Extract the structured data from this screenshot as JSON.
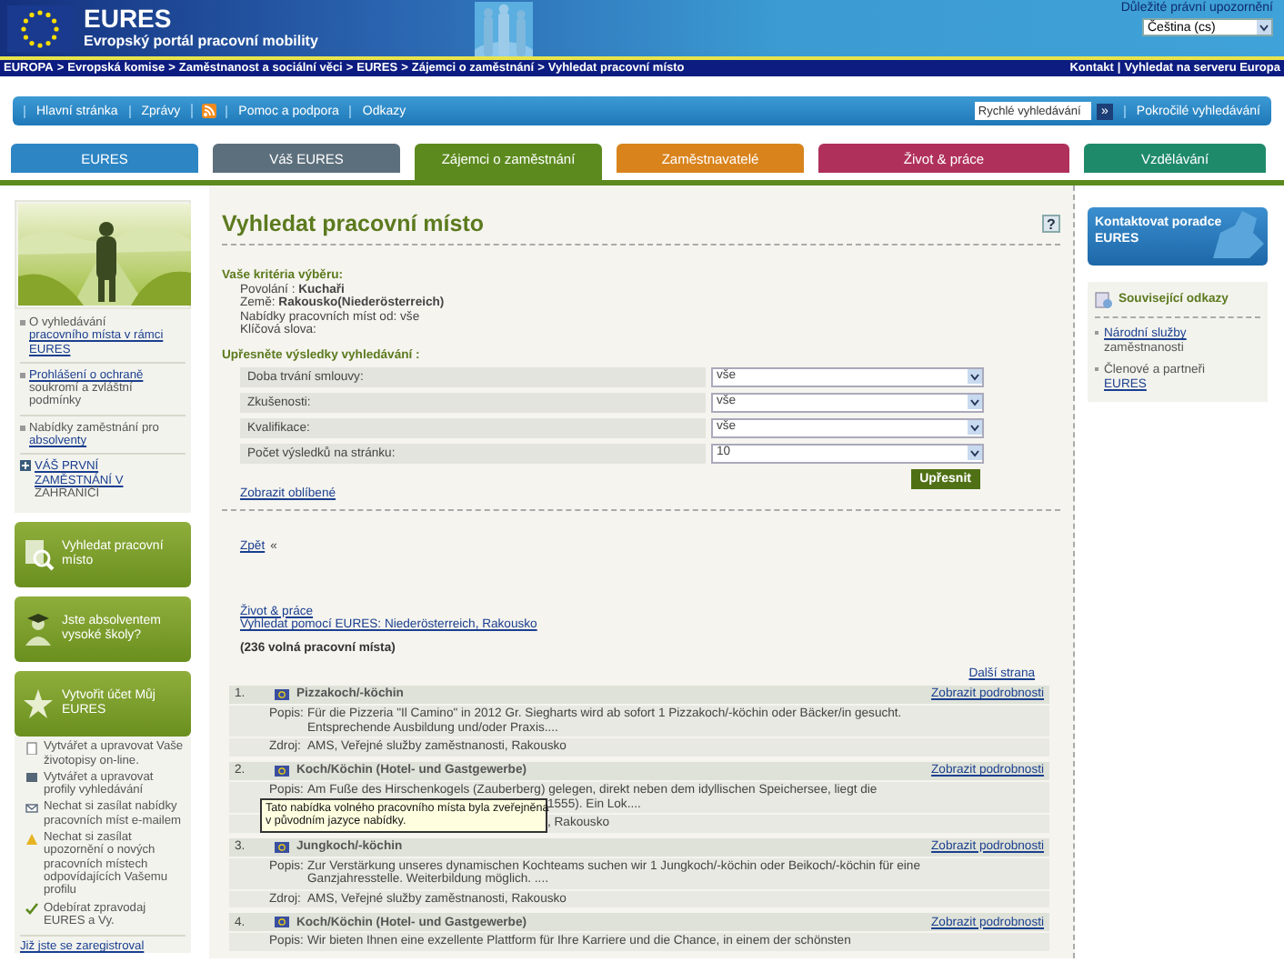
{
  "header": {
    "title": "EURES",
    "subtitle": "Evropský portál pracovní mobility",
    "legal_link": "Důležité právní upozornění",
    "language": "Čeština (cs)"
  },
  "breadcrumb": {
    "separator": ">",
    "items": [
      "EUROPA",
      "Evropská komise",
      "Zaměstnanost a sociální věci",
      "EURES",
      "Zájemci o zaměstnání",
      "Vyhledat pracovní místo"
    ],
    "right_links": [
      "Kontakt",
      "Vyhledat na serveru Europa"
    ],
    "right_separator": "|"
  },
  "nav": {
    "items": [
      {
        "kind": "link",
        "label": "Hlavní stránka"
      },
      {
        "kind": "link",
        "label": "Zprávy"
      },
      {
        "kind": "rss"
      },
      {
        "kind": "link",
        "label": "Pomoc a podpora"
      },
      {
        "kind": "link",
        "label": "Odkazy"
      }
    ],
    "search": {
      "value": "Rychlé vyhledávání",
      "button": "»"
    },
    "advanced": "Pokročilé vyhledávání"
  },
  "tabs": [
    {
      "label": "EURES",
      "color": "#2d85c4",
      "selected": false
    },
    {
      "label": "Váš EURES",
      "color": "#5c6f7c",
      "selected": false
    },
    {
      "label": "Zájemci o zaměstnání",
      "color": "#5c8a1e",
      "selected": true
    },
    {
      "label": "Zaměstnavatelé",
      "color": "#d9831c",
      "selected": false
    },
    {
      "label": "Život & práce",
      "color": "#b0305c",
      "selected": false
    },
    {
      "label": "Vzdělávání",
      "color": "#1f8a6a",
      "selected": false
    }
  ],
  "sidebar": {
    "links": [
      {
        "kind": "bullet",
        "lines": [
          {
            "text": "O vyhledávání",
            "link": false
          },
          {
            "text": "pracovního místa v rámci",
            "link": true
          },
          {
            "text": "EURES",
            "link": true
          }
        ]
      },
      {
        "kind": "bullet",
        "lines": [
          {
            "text": "Prohlášení o ochraně",
            "link": true
          },
          {
            "text": "soukromí a zvláštní",
            "link": false
          },
          {
            "text": "podmínky",
            "link": false
          }
        ]
      },
      {
        "kind": "bullet",
        "lines": [
          {
            "text": "Nabídky zaměstnání pro",
            "link": false
          },
          {
            "text": "absolventy",
            "link": true
          }
        ]
      },
      {
        "kind": "plus",
        "lines": [
          {
            "text": "VÁŠ PRVNÍ",
            "link": true
          },
          {
            "text": "ZAMĚSTNÁNÍ V",
            "link": true
          },
          {
            "text": "ZAHRANIČÍ",
            "link": false
          }
        ]
      }
    ],
    "boxes": [
      {
        "kind": "search",
        "label": "Vyhledat pracovní místo"
      },
      {
        "kind": "graduate",
        "label": "Jste absolventem vysoké školy?"
      },
      {
        "kind": "star",
        "label": "Vytvořit účet Můj EURES"
      }
    ],
    "features": [
      {
        "kind": "cv",
        "text": "Vytvářet a upravovat Vaše životopisy on-line."
      },
      {
        "kind": "profile",
        "text": "Vytvářet a upravovat profily vyhledávání"
      },
      {
        "kind": "mail",
        "text": "Nechat si zasílat nabídky pracovních míst e-mailem"
      },
      {
        "kind": "alert",
        "text": "Nechat si zasílat upozornění o nových pracovních místech odpovídajících Vašemu profilu"
      },
      {
        "kind": "check",
        "text": "Odebírat zpravodaj EURES a Vy."
      }
    ],
    "bottom_link": "Již jste se zaregistroval"
  },
  "main": {
    "title": "Vyhledat pracovní místo",
    "help": "?",
    "criteria": {
      "heading": "Vaše kritéria výběru:",
      "lines": [
        "Povolání : **Kuchaři**",
        "Země: **Rakousko(Niederösterreich)**",
        "Nabídky pracovních míst od: vše",
        "Klíčová slova:"
      ]
    },
    "refine": {
      "heading": "Upřesněte výsledky vyhledávání :",
      "rows": [
        {
          "label": "Doba trvání smlouvy:",
          "value": "vše"
        },
        {
          "label": "Zkušenosti:",
          "value": "vše"
        },
        {
          "label": "Kvalifikace:",
          "value": "vše"
        },
        {
          "label": "Počet výsledků na stránku:",
          "value": "10"
        }
      ],
      "button": "Upřesnit"
    },
    "favorites": "Zobrazit oblíbené",
    "back": "Zpět",
    "back_mark": "«",
    "links": [
      "Život & práce",
      "Vyhledat pomocí EURES: Niederösterreich, Rakousko"
    ],
    "count": "(236 volná pracovní místa)",
    "next": "Další strana",
    "jobs": [
      {
        "number": "1.",
        "title": "Pizzakoch/-köchin",
        "details": "Zobrazit podrobnosti",
        "fields": [
          {
            "label": "Popis:",
            "lines": [
              {
                "text": "Für die Pizzeria \"Il Camino\" in 2012 Gr. Siegharts wird ab sofort 1 Pizzakoch/-köchin oder Bäcker/in gesucht."
              },
              {
                "text": "Entsprechende Ausbildung und/oder Praxis...."
              }
            ]
          },
          {
            "label": "Zdroj:",
            "lines": [
              {
                "text": "AMS, Veřejné služby zaměstnanosti, Rakousko"
              }
            ]
          }
        ]
      },
      {
        "number": "2.",
        "title": "Koch/Köchin (Hotel- und Gastgewerbe)",
        "details": "Zobrazit podrobnosti",
        "tooltip": [
          "Tato nabídka volného pracovního místa byla zveřejněna",
          "v původním jazyce nabídky."
        ],
        "fields": [
          {
            "label": "Popis:",
            "lines": [
              {
                "text": "Am Fuße des Hirschenkogels (Zauberberg) gelegen, direkt neben dem idyllischen Speichersee, liegt die",
                "covered": false
              },
              {
                "text": "1555). Ein Lok....",
                "covered": true
              }
            ]
          },
          {
            "lines": [
              {
                "text": ", Rakousko",
                "covered": true
              }
            ]
          }
        ]
      },
      {
        "number": "3.",
        "title": "Jungkoch/-köchin",
        "details": "Zobrazit podrobnosti",
        "fields": [
          {
            "label": "Popis:",
            "lines": [
              {
                "text": "Zur Verstärkung unseres dynamischen Kochteams suchen wir 1 Jungkoch/-köchin oder Beikoch/-köchin für eine"
              },
              {
                "text": "Ganzjahresstelle. Weiterbildung möglich. ...."
              }
            ]
          },
          {
            "label": "Zdroj:",
            "lines": [
              {
                "text": "AMS, Veřejné služby zaměstnanosti, Rakousko"
              }
            ]
          }
        ]
      },
      {
        "number": "4.",
        "title": "Koch/Köchin (Hotel- und Gastgewerbe)",
        "details": "Zobrazit podrobnosti",
        "fields": [
          {
            "label": "Popis:",
            "lines": [
              {
                "text": "Wir bieten Ihnen eine exzellente Plattform für Ihre Karriere und die Chance, in einem der schönsten"
              }
            ]
          }
        ]
      }
    ]
  },
  "right": {
    "contact": "Kontaktovat poradce EURES",
    "related": {
      "heading": "Související odkazy",
      "items": [
        {
          "lines": [
            {
              "text": "Národní služby",
              "link": true
            },
            {
              "text": "zaměstnanosti",
              "link": false
            }
          ]
        },
        {
          "lines": [
            {
              "text": "Členové a partneři",
              "link": false
            },
            {
              "text": "EURES",
              "link": true
            }
          ]
        }
      ]
    }
  }
}
